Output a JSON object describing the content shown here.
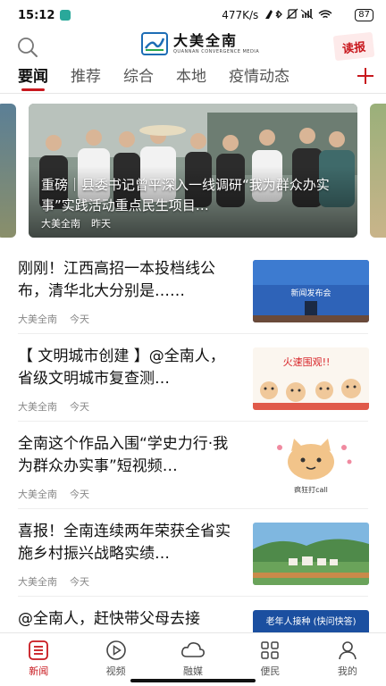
{
  "status": {
    "time": "15:12",
    "net_speed": "477K/s",
    "battery": "87"
  },
  "header": {
    "logo_cn": "大美全南",
    "logo_en": "QUANNAN CONVERGENCE MEDIA",
    "read_label": "读报"
  },
  "tabs": [
    {
      "label": "要闻",
      "active": true
    },
    {
      "label": "推荐"
    },
    {
      "label": "综合"
    },
    {
      "label": "本地"
    },
    {
      "label": "疫情动态"
    }
  ],
  "carousel": {
    "caption": "重磅｜县委书记曾平深入一线调研“我为群众办实事”实践活动重点民生项目…",
    "source": "大美全南",
    "time": "昨天"
  },
  "news": [
    {
      "title": "刚刚！江西高招一本投档线公布，清华北大分别是……",
      "source": "大美全南",
      "time": "今天",
      "thumb_text": "新闻发布会"
    },
    {
      "title": "【 文明城市创建 】@全南人，省级文明城市复查测…",
      "source": "大美全南",
      "time": "今天",
      "thumb_text": "火速围观!!"
    },
    {
      "title": "全南这个作品入围“学史力行·我为群众办实事”短视频…",
      "source": "大美全南",
      "time": "今天",
      "thumb_text": "疯狂打call"
    },
    {
      "title": "喜报！全南连续两年荣获全省实施乡村振兴战略实绩…",
      "source": "大美全南",
      "time": "今天",
      "thumb_text": ""
    },
    {
      "title": "@全南人，赶快带父母去接",
      "source": "",
      "time": "",
      "thumb_text": "老年人接种 (快问快答)"
    }
  ],
  "bottom_nav": [
    {
      "label": "新闻",
      "icon": "news-icon",
      "active": true
    },
    {
      "label": "视频",
      "icon": "play-icon"
    },
    {
      "label": "融媒",
      "icon": "cloud-icon"
    },
    {
      "label": "便民",
      "icon": "grid-icon"
    },
    {
      "label": "我的",
      "icon": "user-icon"
    }
  ],
  "colors": {
    "accent": "#c8181e",
    "brand_blue": "#1d6db5"
  }
}
